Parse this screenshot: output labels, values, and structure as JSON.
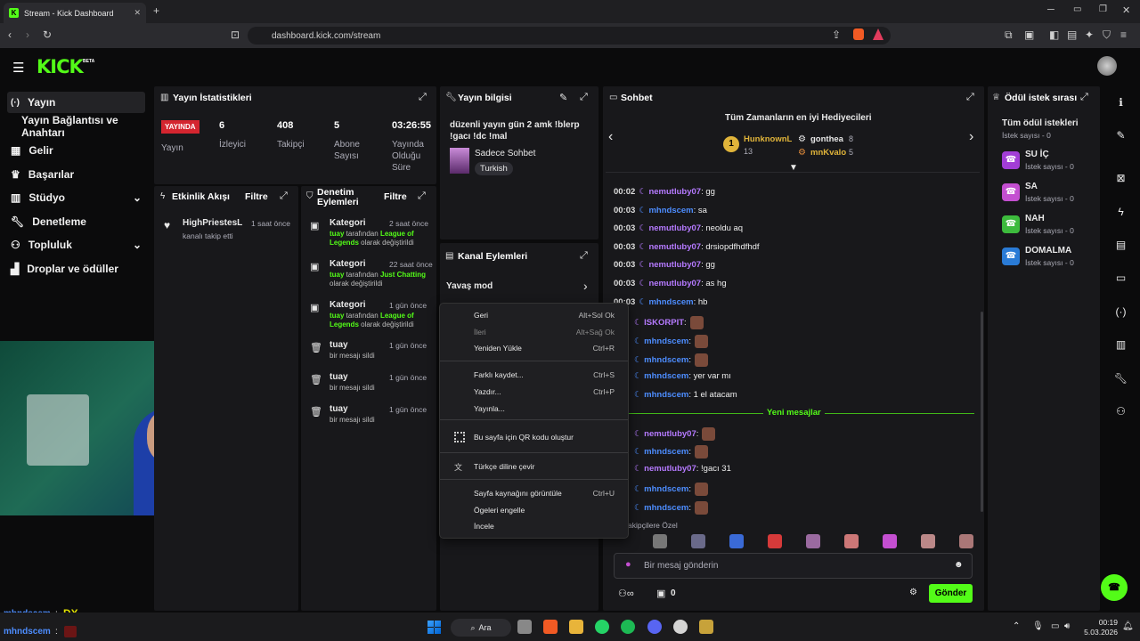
{
  "browser": {
    "tab_title": "Stream - Kick Dashboard",
    "url": "dashboard.kick.com/stream"
  },
  "app": {
    "logo": "KICK",
    "beta": "BETA"
  },
  "sidebar": {
    "items": [
      {
        "label": "Yayın",
        "icon": "stream-icon"
      },
      {
        "label": "Yayın Bağlantısı ve Anahtarı"
      },
      {
        "label": "Gelir",
        "icon": "income-icon"
      },
      {
        "label": "Başarılar",
        "icon": "trophy-icon"
      },
      {
        "label": "Stüdyo",
        "icon": "studio-icon"
      },
      {
        "label": "Denetleme",
        "icon": "wrench-icon"
      },
      {
        "label": "Topluluk",
        "icon": "people-icon"
      },
      {
        "label": "Droplar ve ödüller",
        "icon": "drops-icon"
      }
    ]
  },
  "stats": {
    "title": "Yayın İstatistikleri",
    "live_badge": "YAYINDA",
    "live_label": "Yayın",
    "items": [
      {
        "value": "6",
        "label": "İzleyici"
      },
      {
        "value": "408",
        "label": "Takipçi"
      },
      {
        "value": "5",
        "label": "Abone Sayısı"
      },
      {
        "value": "03:26:55",
        "label": "Yayında Olduğu Süre"
      }
    ]
  },
  "activity": {
    "title": "Etkinlik Akışı",
    "filter": "Filtre",
    "items": [
      {
        "name": "HighPriestesL",
        "time": "1 saat önce",
        "text": "kanalı takip etti"
      }
    ]
  },
  "moderation": {
    "title": "Denetim Eylemleri",
    "filter": "Filtre",
    "items": [
      {
        "title": "Kategori",
        "time": "2 saat önce",
        "user": "tuay",
        "mid": " tarafından ",
        "value": "League of Legends",
        "tail": " olarak değiştirildi"
      },
      {
        "title": "Kategori",
        "time": "22 saat önce",
        "user": "tuay",
        "mid": " tarafından ",
        "value": "Just Chatting",
        "tail": " olarak değiştirildi"
      },
      {
        "title": "Kategori",
        "time": "1 gün önce",
        "user": "tuay",
        "mid": " tarafından ",
        "value": "League of Legends",
        "tail": " olarak değiştirildi"
      },
      {
        "title": "tuay",
        "time": "1 gün önce",
        "text": "bir mesajı sildi"
      },
      {
        "title": "tuay",
        "time": "1 gün önce",
        "text": "bir mesajı sildi"
      },
      {
        "title": "tuay",
        "time": "1 gün önce",
        "text": "bir mesajı sildi"
      }
    ]
  },
  "streaminfo": {
    "title": "Yayın bilgisi",
    "stream_title": "düzenli yayın gün 2 amk !blerp !gacı !dc !mal",
    "category": "Sadece Sohbet",
    "language": "Turkish"
  },
  "channel_actions": {
    "title": "Kanal Eylemleri",
    "slow_mode": "Yavaş mod"
  },
  "chat": {
    "title": "Sohbet",
    "top_gifters_title": "Tüm Zamanların en iyi Hediyecileri",
    "gifters": [
      {
        "name": "HunknownL",
        "count": "13"
      },
      {
        "name": "gonthea",
        "count": "8"
      },
      {
        "name": "mnKvalo",
        "count": "5"
      }
    ],
    "lines": [
      {
        "time": "00:02",
        "name": "nemutluby07",
        "text": ": gg",
        "color": "p"
      },
      {
        "time": "00:03",
        "name": "mhndscem",
        "text": ": sa",
        "color": "b"
      },
      {
        "time": "00:03",
        "name": "nemutluby07",
        "text": ": neoldu aq",
        "color": "p"
      },
      {
        "time": "00:03",
        "name": "nemutluby07",
        "text": ": drsiopdfhdfhdf",
        "color": "p"
      },
      {
        "time": "00:03",
        "name": "nemutluby07",
        "text": ": gg",
        "color": "p"
      },
      {
        "time": "00:03",
        "name": "nemutluby07",
        "text": ": as hg",
        "color": "p"
      },
      {
        "time": "00:03",
        "name": "mhndscem",
        "text": ": hb",
        "color": "b"
      }
    ],
    "lines2": [
      {
        "name": "ISKORPIT",
        "text": ":",
        "color": "p"
      },
      {
        "name": "mhndscem",
        "text": ":",
        "color": "b"
      },
      {
        "name": "mhndscem",
        "text": ":",
        "color": "b"
      },
      {
        "name": "mhndscem",
        "text": ": yer var mı",
        "color": "b"
      },
      {
        "name": "mhndscem",
        "text": ": 1 el atacam",
        "color": "b"
      }
    ],
    "new_messages": "Yeni mesajlar",
    "lines3": [
      {
        "name": "nemutluby07",
        "text": ":",
        "color": "p"
      },
      {
        "name": "mhndscem",
        "text": ":",
        "color": "b"
      },
      {
        "name": "nemutluby07",
        "text": ": !gacı 31",
        "color": "p"
      },
      {
        "name": "mhndscem",
        "text": ":",
        "color": "b"
      },
      {
        "name": "mhndscem",
        "text": ":",
        "color": "b"
      }
    ],
    "subs_label": "akipçilere Özel",
    "input_placeholder": "Bir mesaj gönderin",
    "points": "0",
    "send": "Gönder"
  },
  "rewards": {
    "title": "Ödül istek sırası",
    "all": "Tüm ödül istekleri",
    "all_count": "İstek sayısı - 0",
    "items": [
      {
        "name": "SU İÇ",
        "count": "İstek sayısı - 0",
        "color": "#a23dd6"
      },
      {
        "name": "SA",
        "count": "İstek sayısı - 0",
        "color": "#c44fd1"
      },
      {
        "name": "NAH",
        "count": "İstek sayısı - 0",
        "color": "#3dbb3d"
      },
      {
        "name": "DOMALMA",
        "count": "İstek sayısı - 0",
        "color": "#2a7bd6"
      }
    ]
  },
  "context_menu": {
    "items": [
      {
        "label": "Geri",
        "key": "Alt+Sol Ok"
      },
      {
        "label": "İleri",
        "key": "Alt+Sağ Ok"
      },
      {
        "label": "Yeniden Yükle",
        "key": "Ctrl+R"
      },
      {
        "label": "Farklı kaydet...",
        "key": "Ctrl+S"
      },
      {
        "label": "Yazdır...",
        "key": "Ctrl+P"
      },
      {
        "label": "Yayınla..."
      },
      {
        "label": "Bu sayfa için QR kodu oluştur"
      },
      {
        "label": "Türkçe diline çevir"
      },
      {
        "label": "Sayfa kaynağını görüntüle",
        "key": "Ctrl+U"
      },
      {
        "label": "Ögeleri engelle"
      },
      {
        "label": "İncele"
      }
    ]
  },
  "overlay": {
    "line1_name": "mhndscem",
    "line1_text": "DX",
    "line2_name": "mhndscem"
  },
  "taskbar": {
    "search": "Ara",
    "time": "00:19",
    "date": "5.03.2026"
  }
}
